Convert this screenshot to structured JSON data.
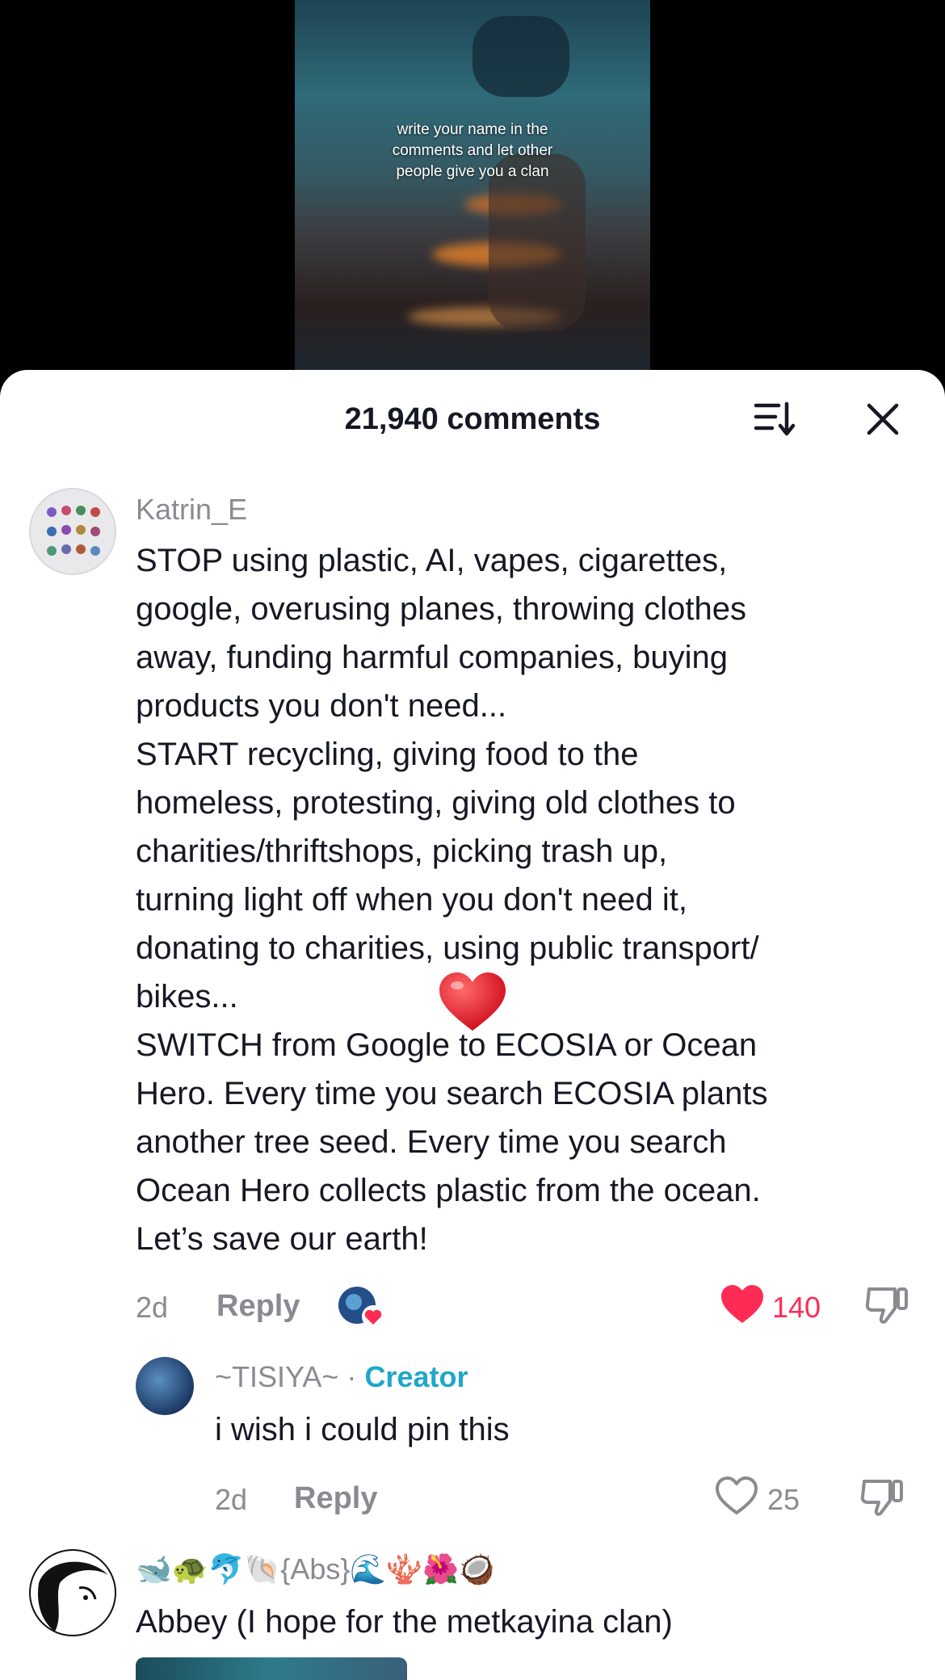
{
  "video": {
    "caption": "write your name in the comments and let other people give you a clan"
  },
  "header": {
    "comment_count": "21,940 comments",
    "sort_icon": "sort-icon",
    "close_icon": "close-icon"
  },
  "comments": [
    {
      "username": "Katrin_E",
      "text": "STOP using plastic, AI, vapes, cigarettes,\ngoogle, overusing planes, throwing clothes\naway, funding harmful companies, buying\nproducts you don't need...\nSTART recycling, giving food to the\nhomeless, protesting, giving old clothes to\ncharities/thriftshops, picking trash up,\nturning light off when you don't need it,\ndonating to charities, using public transport/\nbikes...\nSWITCH from Google to ECOSIA or Ocean\nHero. Every time you search ECOSIA plants\nanother tree seed. Every time you search\nOcean Hero collects plastic from the ocean.\nLet’s save our earth!",
      "time": "2d",
      "reply_label": "Reply",
      "likes": "140",
      "liked": true,
      "liked_by_creator": true
    },
    {
      "username": "~TISIYA~",
      "separator": "·",
      "badge": "Creator",
      "text": "i wish i could pin this",
      "time": "2d",
      "reply_label": "Reply",
      "likes": "25",
      "liked": false
    },
    {
      "username": "🐋🐢🐬🐚{Abs}🌊🪸🌺🥥",
      "text": "Abbey (I hope for the metkayina clan)"
    }
  ],
  "colors": {
    "like_red": "#fe2c55",
    "creator_blue": "#20a7c9",
    "text_primary": "#161823",
    "text_secondary": "#8a8b91"
  }
}
